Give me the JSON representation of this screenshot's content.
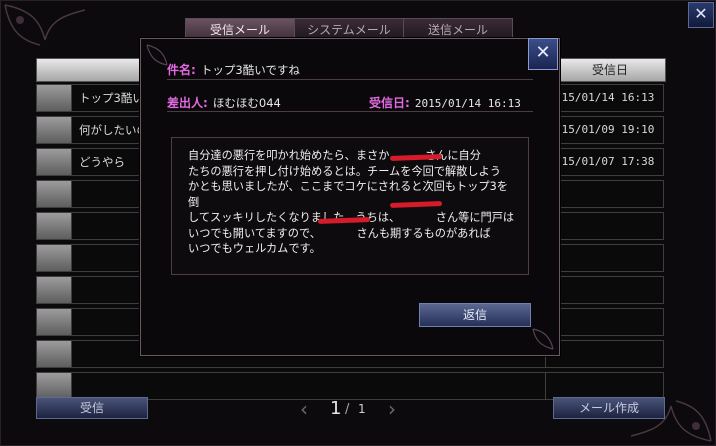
{
  "tabs": [
    {
      "label": "受信メール",
      "active": true
    },
    {
      "label": "システムメール",
      "active": false
    },
    {
      "label": "送信メール",
      "active": false
    }
  ],
  "list": {
    "header_date": "受信日",
    "rows": [
      {
        "subject": "トップ3酷い",
        "date": "015/01/14 16:13"
      },
      {
        "subject": "何がしたいの",
        "date": "015/01/09 19:10"
      },
      {
        "subject": "どうやら",
        "date": "015/01/07 17:38"
      },
      {
        "subject": "",
        "date": ""
      },
      {
        "subject": "",
        "date": ""
      },
      {
        "subject": "",
        "date": ""
      },
      {
        "subject": "",
        "date": ""
      },
      {
        "subject": "",
        "date": ""
      },
      {
        "subject": "",
        "date": ""
      },
      {
        "subject": "",
        "date": ""
      }
    ]
  },
  "bottom": {
    "receive_label": "受信",
    "compose_label": "メール作成",
    "page_current": "1",
    "page_sep": "/",
    "page_total": "1"
  },
  "modal": {
    "subject_label": "件名:",
    "subject_value": "トップ3酷いですね",
    "sender_label": "差出人:",
    "sender_value": "ほむほむ044",
    "received_label": "受信日:",
    "received_value": "2015/01/14 16:13",
    "body": "自分達の悪行を叩かれ始めたら、まさか          さんに自分\nたちの悪行を押し付け始めるとは。チームを今回で解散しよう\nかとも思いましたが、ここまでコケにされると次回もトップ3を倒\nしてスッキリしたくなりました。うちは、          さん等に門戸は\nいつでも開いてますので、          さんも期するものがあれば\nいつでもウェルカムです。",
    "reply_label": "返信"
  },
  "colors": {
    "label_pink": "#e06be0",
    "redact_red": "#d61b2a",
    "button_blue": "#3c4e88"
  }
}
